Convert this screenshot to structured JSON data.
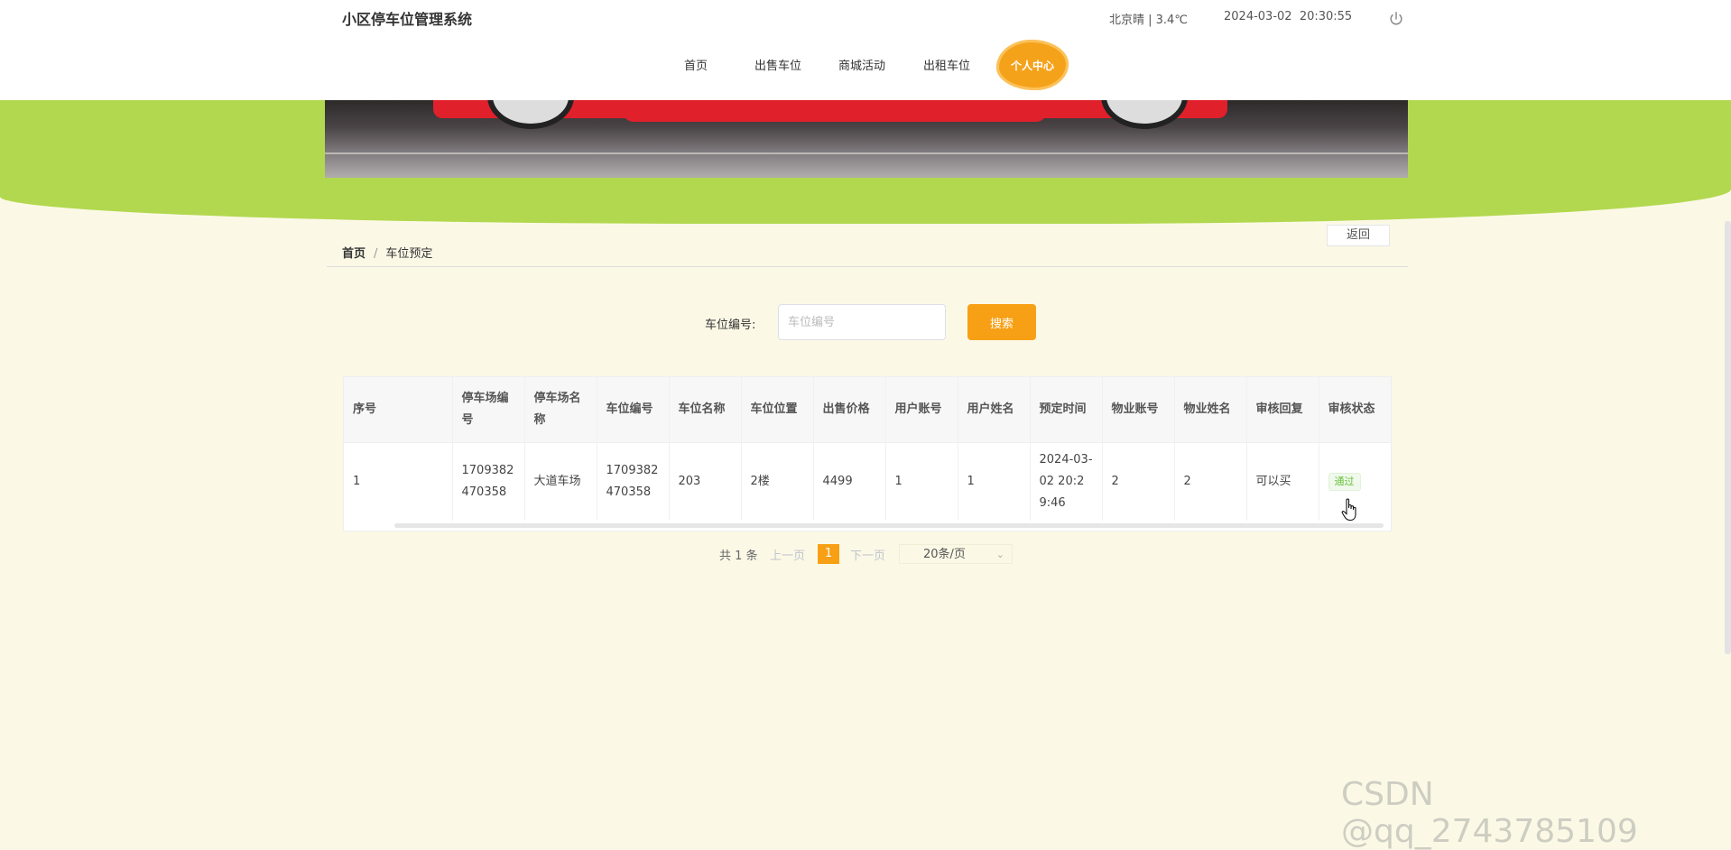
{
  "header": {
    "app_title": "小区停车位管理系统",
    "weather": "北京晴 | 3.4℃",
    "datetime": "2024-03-02  20:30:55",
    "power_icon": "power-icon"
  },
  "nav": {
    "items": [
      "首页",
      "出售车位",
      "商城活动",
      "出租车位"
    ],
    "personal_center": "个人中心"
  },
  "breadcrumb": {
    "home": "首页",
    "separator": "/",
    "current": "车位预定",
    "return_label": "返回"
  },
  "search": {
    "label": "车位编号:",
    "placeholder": "车位编号",
    "button": "搜索"
  },
  "table": {
    "headers": [
      "序号",
      "停车场编号",
      "停车场名称",
      "车位编号",
      "车位名称",
      "车位位置",
      "出售价格",
      "用户账号",
      "用户姓名",
      "预定时间",
      "物业账号",
      "物业姓名",
      "审核回复",
      "审核状态"
    ],
    "rows": [
      {
        "index": "1",
        "lot_no": "1709382470358",
        "lot_name": "大道车场",
        "space_no": "1709382470358",
        "space_name": "203",
        "space_location": "2楼",
        "price": "4499",
        "user_account": "1",
        "user_name": "1",
        "reserve_time": "2024-03-02 20:29:46",
        "property_account": "2",
        "property_name": "2",
        "review_reply": "可以买",
        "review_status": "通过"
      }
    ]
  },
  "pagination": {
    "total": "共 1 条",
    "prev": "上一页",
    "page": "1",
    "next": "下一页",
    "page_size": "20条/页"
  },
  "watermark": "CSDN @qq_2743785109",
  "colors": {
    "accent": "#f7a016",
    "banner_green": "#b2d84f",
    "page_bg": "#fbf9e6",
    "status_green": "#67c23a"
  }
}
